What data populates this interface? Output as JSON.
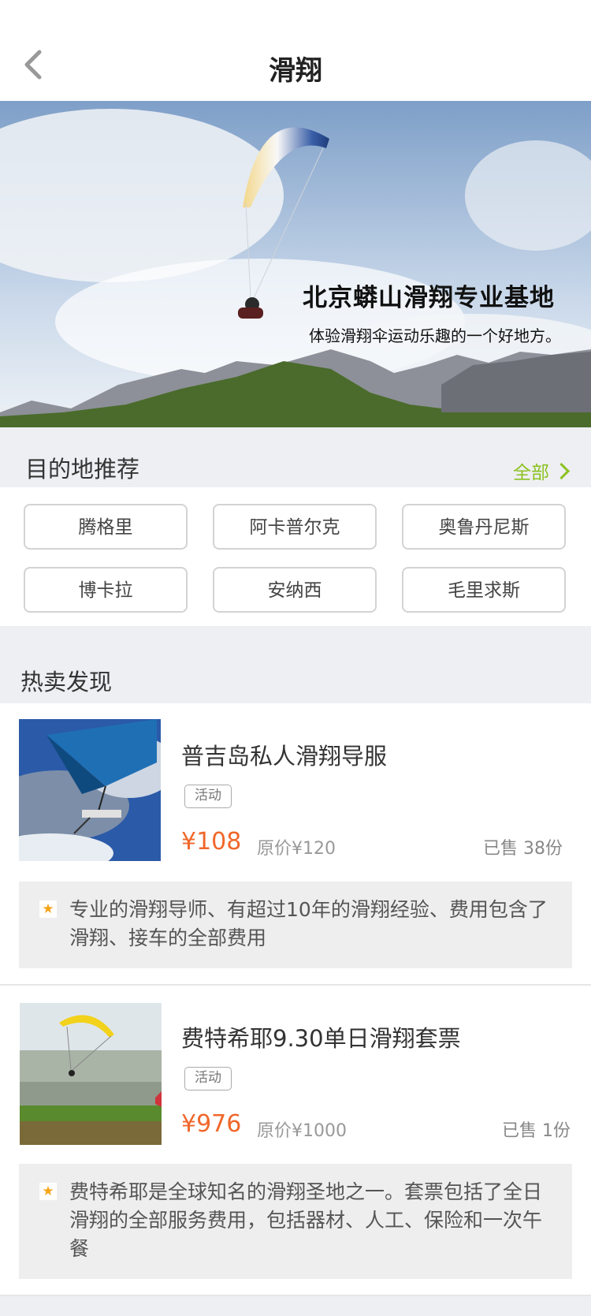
{
  "header": {
    "title": "滑翔",
    "back_icon": "chevron-left-icon"
  },
  "banner": {
    "title": "北京蟒山滑翔专业基地",
    "subtitle": "体验滑翔伞运动乐趣的一个好地方。"
  },
  "destinations": {
    "heading": "目的地推荐",
    "all_label": "全部",
    "items": [
      "腾格里",
      "阿卡普尔克",
      "奥鲁丹尼斯",
      "博卡拉",
      "安纳西",
      "毛里求斯"
    ]
  },
  "hot": {
    "heading": "热卖发现",
    "products": [
      {
        "name": "普吉岛私人滑翔导服",
        "tag": "活动",
        "price": "¥108",
        "original_price": "原价¥120",
        "sold": "已售 38份",
        "description": "专业的滑翔导师、有超过10年的滑翔经验、费用包含了滑翔、接车的全部费用"
      },
      {
        "name": "费特希耶9.30单日滑翔套票",
        "tag": "活动",
        "price": "¥976",
        "original_price": "原价¥1000",
        "sold": "已售 1份",
        "description": "费特希耶是全球知名的滑翔圣地之一。套票包括了全日滑翔的全部服务费用，包括器材、人工、保险和一次午餐"
      }
    ]
  },
  "colors": {
    "accent_green": "#8bc21f",
    "price_orange": "#f0672a",
    "star_yellow": "#f5a51a"
  }
}
